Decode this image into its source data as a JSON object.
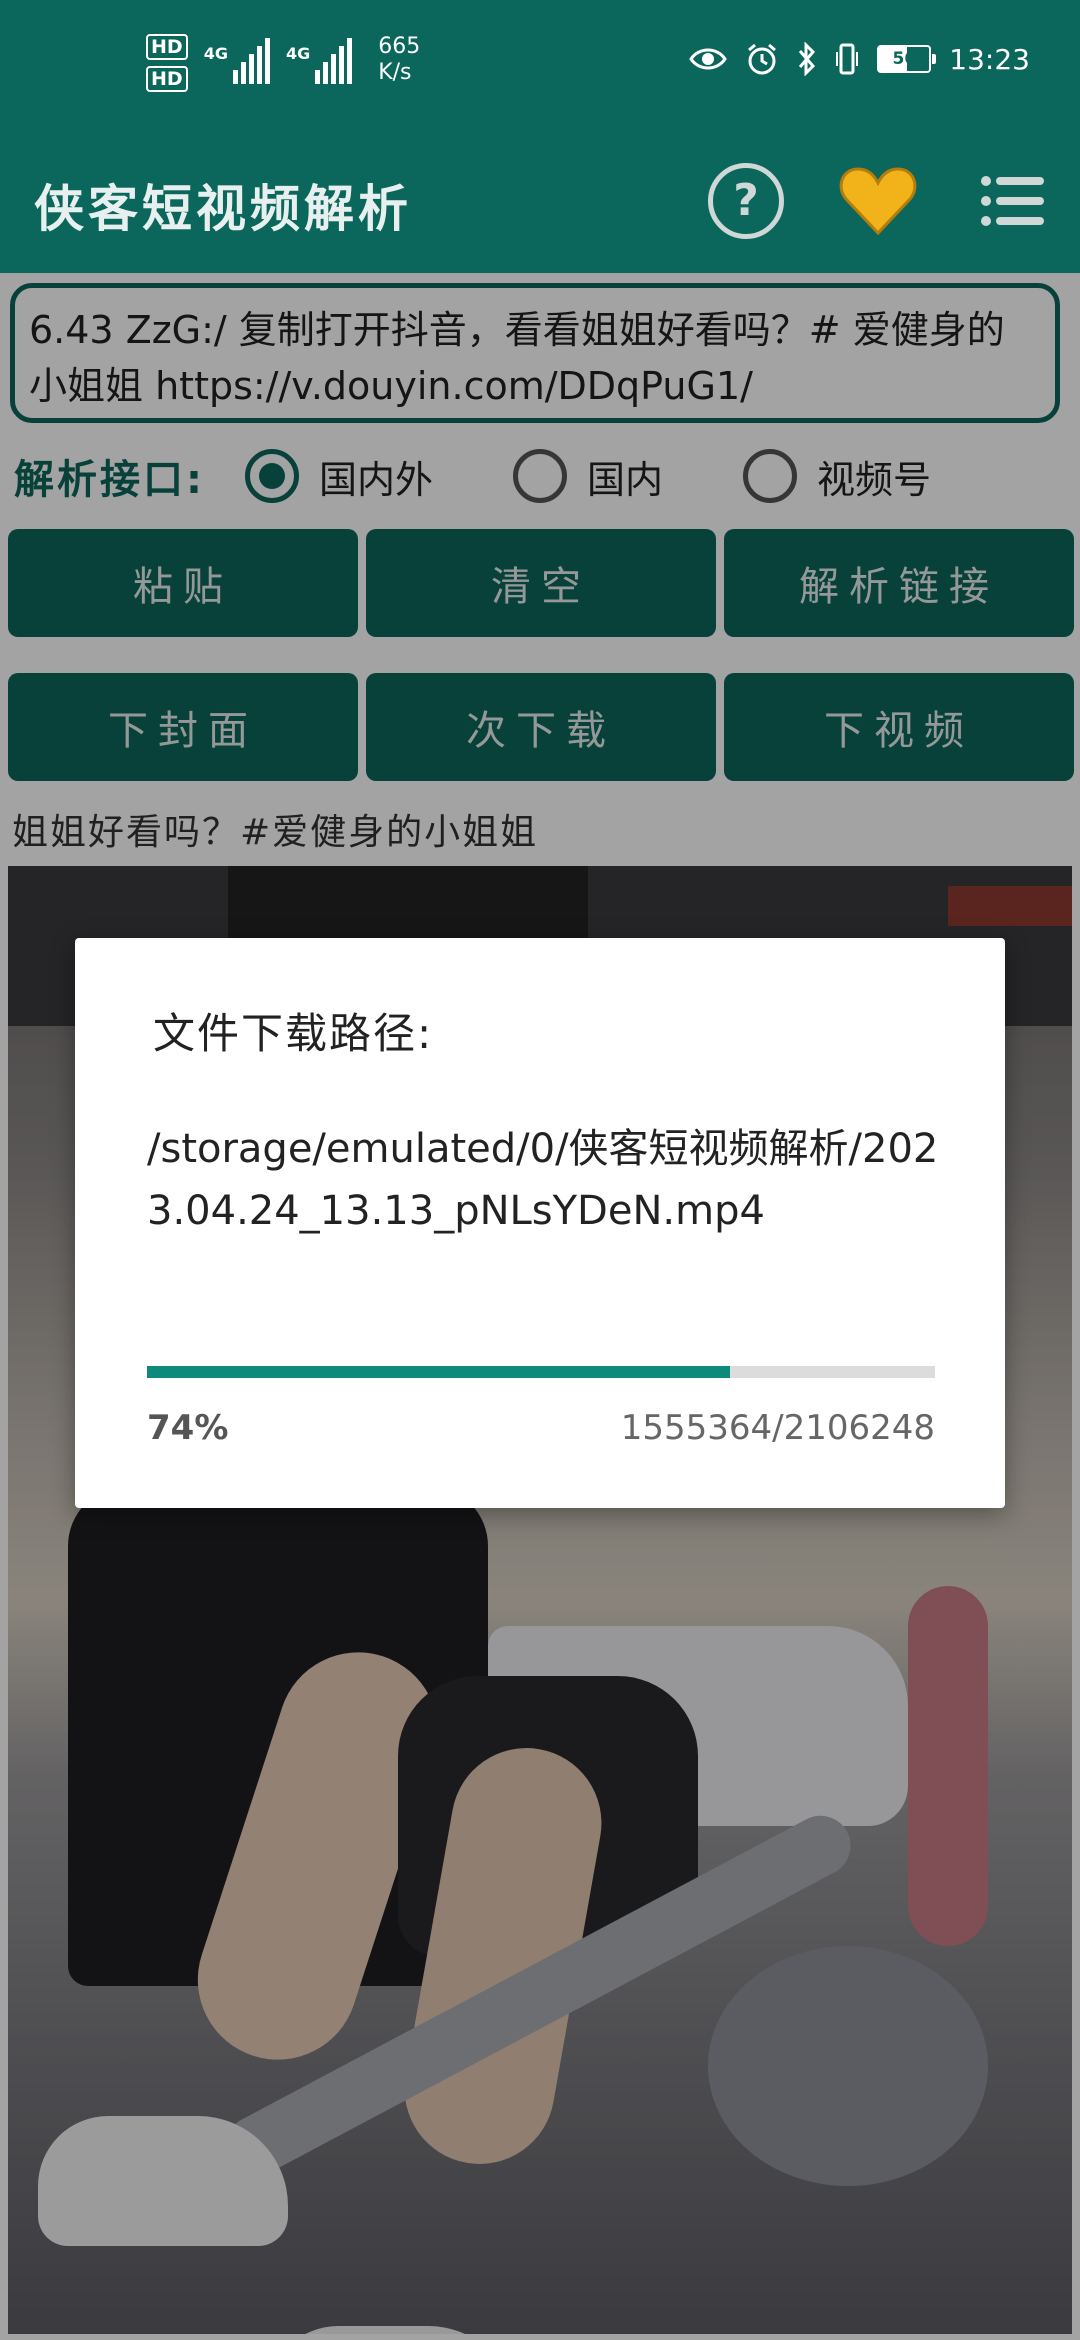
{
  "status_bar": {
    "hd1": "HD",
    "hd2": "HD",
    "sim1_label": "4G",
    "sim2_label": "4G",
    "net_speed_value": "665",
    "net_speed_unit": "K/s",
    "icons": [
      "eye-icon",
      "alarm-icon",
      "bluetooth-icon",
      "vibrate-icon"
    ],
    "battery_level": 56,
    "battery_text": "56",
    "time": "13:23"
  },
  "app_bar": {
    "title": "侠客短视频解析",
    "help_glyph": "?",
    "heart_color": "#f2b31a",
    "accent": "#0b675c"
  },
  "form": {
    "url_text": "6.43 ZzG:/ 复制打开抖音，看看姐姐好看吗？# 爱健身的小姐姐 https://v.douyin.com/DDqPuG1/",
    "api_label": "解析接口:",
    "options": [
      {
        "label": "国内外",
        "selected": true
      },
      {
        "label": "国内",
        "selected": false
      },
      {
        "label": "视频号",
        "selected": false
      }
    ],
    "buttons_row1": [
      "粘贴",
      "清空",
      "解析链接"
    ],
    "buttons_row2": [
      "下封面",
      "次下载",
      "下视频"
    ],
    "description": "姐姐好看吗？#爱健身的小姐姐"
  },
  "dialog": {
    "title": "文件下载路径:",
    "path": "/storage/emulated/0/侠客短视频解析/2023.04.24_13.13_pNLsYDeN.mp4",
    "progress_percent": 74,
    "progress_text": "74%",
    "bytes_text": "1555364/2106248"
  }
}
